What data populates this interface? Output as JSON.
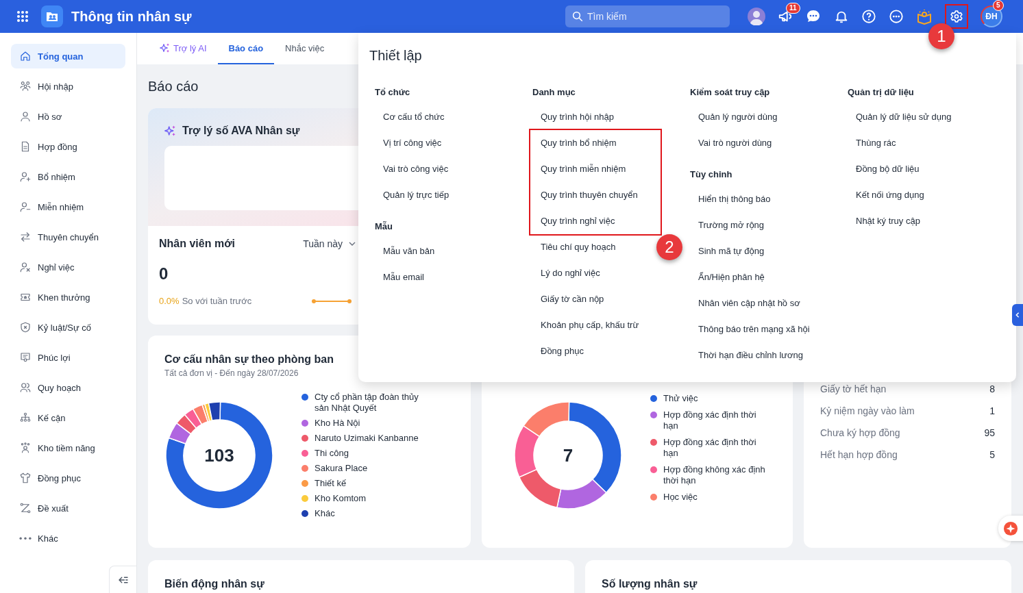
{
  "app": {
    "title": "Thông tin nhân sự"
  },
  "search": {
    "placeholder": "Tìm kiếm"
  },
  "notifications_badge": "11",
  "settings": {
    "highlighted": true,
    "marker": "1"
  },
  "profile": {
    "initials": "ĐH",
    "badge": "5"
  },
  "sidebar": {
    "items": [
      {
        "label": "Tổng quan",
        "selected": true
      },
      {
        "label": "Hội nhập",
        "selected": false
      },
      {
        "label": "Hồ sơ",
        "selected": false
      },
      {
        "label": "Hợp đồng",
        "selected": false
      },
      {
        "label": "Bổ nhiệm",
        "selected": false
      },
      {
        "label": "Miễn nhiệm",
        "selected": false
      },
      {
        "label": "Thuyên chuyển",
        "selected": false
      },
      {
        "label": "Nghỉ việc",
        "selected": false
      },
      {
        "label": "Khen thưởng",
        "selected": false
      },
      {
        "label": "Kỷ luật/Sự cố",
        "selected": false
      },
      {
        "label": "Phúc lợi",
        "selected": false
      },
      {
        "label": "Quy hoạch",
        "selected": false
      },
      {
        "label": "Kế cận",
        "selected": false
      },
      {
        "label": "Kho tiềm năng",
        "selected": false
      },
      {
        "label": "Đồng phục",
        "selected": false
      },
      {
        "label": "Đề xuất",
        "selected": false
      },
      {
        "label": "Khác",
        "selected": false
      }
    ]
  },
  "tabs": [
    {
      "label": "Trợ lý AI",
      "kind": "ai",
      "selected": false
    },
    {
      "label": "Báo cáo",
      "kind": "plain",
      "selected": true
    },
    {
      "label": "Nhắc việc",
      "kind": "plain",
      "selected": false
    }
  ],
  "page_title": "Báo cáo",
  "assistant_card": {
    "title": "Trợ lý số AVA Nhân sự"
  },
  "new_employees": {
    "title": "Nhân viên mới",
    "period": "Tuần này",
    "value": "0",
    "change": "0.0%",
    "comparison": "So với tuần trước"
  },
  "department_chart": {
    "title": "Cơ cấu nhân sự theo phòng ban",
    "subtitle": "Tất cả đơn vị  -  Đến ngày 28/07/2026",
    "total": "103",
    "legend": [
      {
        "label": "Cty cổ phần tập đoàn thủy sản Nhật Quyết",
        "color": "#2563dd"
      },
      {
        "label": "Kho Hà Nội",
        "color": "#b066e0"
      },
      {
        "label": "Naruto Uzimaki Kanbanne",
        "color": "#ee5a6a"
      },
      {
        "label": "Thi công",
        "color": "#f95f95"
      },
      {
        "label": "Sakura Place",
        "color": "#fb7e6b"
      },
      {
        "label": "Thiết kế",
        "color": "#fb9b47"
      },
      {
        "label": "Kho Komtom",
        "color": "#fbcb3c"
      },
      {
        "label": "Khác",
        "color": "#1e40af"
      }
    ]
  },
  "contract_chart": {
    "total": "7",
    "legend": [
      {
        "label": "Thử việc",
        "color": "#2563dd"
      },
      {
        "label": "Hợp đồng xác định thời hạn",
        "color": "#b066e0"
      },
      {
        "label": "Hợp đồng xác định thời hạn",
        "color": "#ee5a6a"
      },
      {
        "label": "Hợp đồng không xác định thời hạn",
        "color": "#f95f95"
      },
      {
        "label": "Học việc",
        "color": "#fb7e6b"
      }
    ]
  },
  "reminders": [
    {
      "label": "Giấy tờ hết hạn",
      "count": "8"
    },
    {
      "label": "Kỷ niệm ngày vào làm",
      "count": "1"
    },
    {
      "label": "Chưa ký hợp đồng",
      "count": "95"
    },
    {
      "label": "Hết hạn hợp đồng",
      "count": "5"
    }
  ],
  "bottom_cards": [
    {
      "title": "Biến động nhân sự"
    },
    {
      "title": "Số lượng nhân sự"
    }
  ],
  "settings_panel": {
    "title": "Thiết lập",
    "columns": [
      {
        "groups": [
          {
            "heading": "Tổ chức",
            "items": [
              {
                "label": "Cơ cấu tổ chức",
                "highlighted": false
              },
              {
                "label": "Vị trí công việc",
                "highlighted": false
              },
              {
                "label": "Vai trò công việc",
                "highlighted": false
              },
              {
                "label": "Quản lý trực tiếp",
                "highlighted": false
              }
            ]
          },
          {
            "heading": "Mẫu",
            "items": [
              {
                "label": "Mẫu văn bản",
                "highlighted": false
              },
              {
                "label": "Mẫu email",
                "highlighted": false
              }
            ]
          }
        ]
      },
      {
        "groups": [
          {
            "heading": "Danh mục",
            "marker": "2",
            "items": [
              {
                "label": "Quy trình hội nhập",
                "highlighted": false
              },
              {
                "label": "Quy trình bổ nhiệm",
                "highlighted": true
              },
              {
                "label": "Quy trình miễn nhiệm",
                "highlighted": true
              },
              {
                "label": "Quy trình thuyên chuyển",
                "highlighted": true
              },
              {
                "label": "Quy trình nghỉ việc",
                "highlighted": true
              },
              {
                "label": "Tiêu chí quy hoạch",
                "highlighted": false
              },
              {
                "label": "Lý do nghỉ việc",
                "highlighted": false
              },
              {
                "label": "Giấy tờ cần nộp",
                "highlighted": false
              },
              {
                "label": "Khoản phụ cấp, khấu trừ",
                "highlighted": false
              },
              {
                "label": "Đồng phục",
                "highlighted": false
              }
            ]
          }
        ]
      },
      {
        "groups": [
          {
            "heading": "Kiểm soát truy cập",
            "items": [
              {
                "label": "Quản lý người dùng",
                "highlighted": false
              },
              {
                "label": "Vai trò người dùng",
                "highlighted": false
              }
            ]
          },
          {
            "heading": "Tùy chỉnh",
            "items": [
              {
                "label": "Hiển thị thông báo",
                "highlighted": false
              },
              {
                "label": "Trường mở rộng",
                "highlighted": false
              },
              {
                "label": "Sinh mã tự động",
                "highlighted": false
              },
              {
                "label": "Ẩn/Hiện phân hệ",
                "highlighted": false
              },
              {
                "label": "Nhân viên cập nhật hồ sơ",
                "highlighted": false
              },
              {
                "label": "Thông báo trên mạng xã hội",
                "highlighted": false
              },
              {
                "label": "Thời hạn điều chỉnh lương",
                "highlighted": false
              }
            ]
          }
        ]
      },
      {
        "groups": [
          {
            "heading": "Quản trị dữ liệu",
            "items": [
              {
                "label": "Quản lý dữ liệu sử dụng",
                "highlighted": false
              },
              {
                "label": "Thùng rác",
                "highlighted": false
              },
              {
                "label": "Đồng bộ dữ liệu",
                "highlighted": false
              },
              {
                "label": "Kết nối ứng dụng",
                "highlighted": false
              },
              {
                "label": "Nhật ký truy cập",
                "highlighted": false
              }
            ]
          }
        ]
      }
    ]
  }
}
